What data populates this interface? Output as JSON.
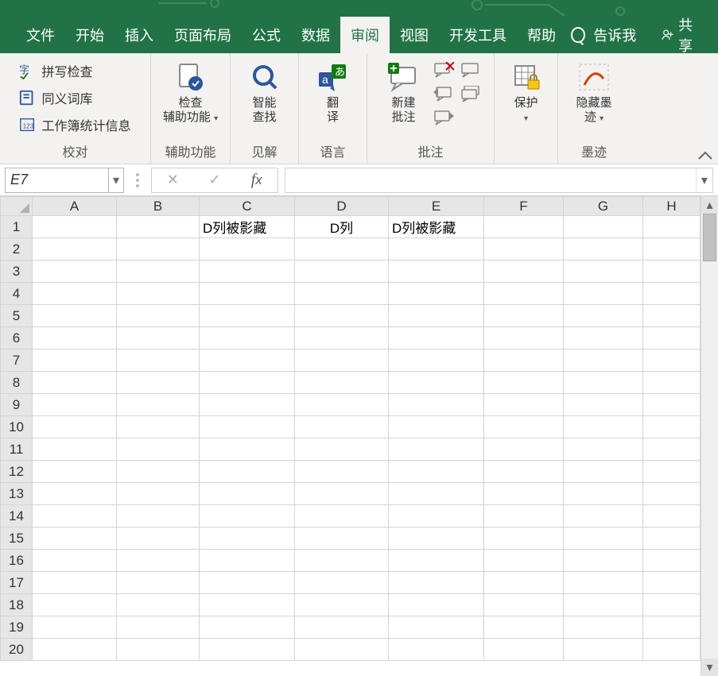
{
  "tabs": {
    "file": "文件",
    "home": "开始",
    "insert": "插入",
    "layout": "页面布局",
    "formulas": "公式",
    "data": "数据",
    "review": "审阅",
    "view": "视图",
    "dev": "开发工具",
    "help": "帮助",
    "tellme": "告诉我",
    "share": "共享"
  },
  "ribbon": {
    "proofing": {
      "spell": "拼写检查",
      "thesaurus": "同义词库",
      "stats": "工作簿统计信息",
      "label": "校对"
    },
    "access": {
      "check": "检查",
      "sub": "辅助功能",
      "label": "辅助功能"
    },
    "insights": {
      "smart": "智能",
      "lookup": "查找",
      "label": "见解"
    },
    "lang": {
      "translate": "翻",
      "translate2": "译",
      "label": "语言"
    },
    "comments": {
      "new": "新建",
      "note": "批注",
      "label": "批注"
    },
    "protect": {
      "protect": "保护",
      "label": ""
    },
    "ink": {
      "hide": "隐藏墨",
      "trace": "迹",
      "label": "墨迹"
    }
  },
  "fbar": {
    "name": "E7",
    "formula": ""
  },
  "columns": [
    "A",
    "B",
    "C",
    "D",
    "E",
    "F",
    "G",
    "H"
  ],
  "rows": 20,
  "cells": {
    "C1": "D列被影藏",
    "D1": "D列",
    "E1": "D列被影藏"
  }
}
